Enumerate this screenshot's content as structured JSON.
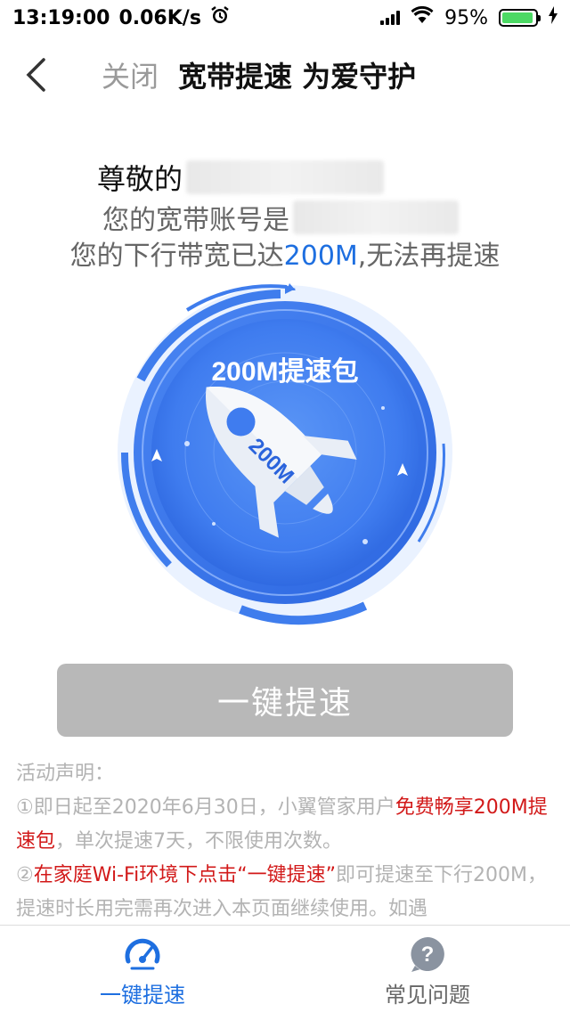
{
  "status_bar": {
    "time": "13:19:00",
    "net_speed": "0.06K/s",
    "battery_percent": "95%",
    "battery_level": 0.95
  },
  "nav": {
    "close_label": "关闭",
    "title": "宽带提速 为爱守护"
  },
  "greeting": {
    "line1_prefix": "尊敬的",
    "line2_prefix": "您的宽带账号是",
    "line3_before": "您的下行带宽已达",
    "line3_speed": "200M",
    "line3_after": ",无法再提速"
  },
  "hero": {
    "package_label": "200M提速包",
    "rocket_badge": "200M",
    "colors": {
      "primary": "#2f6fe6",
      "light": "#5a93f5"
    }
  },
  "boost_button": {
    "label": "一键提速"
  },
  "notice": {
    "title": "活动声明：",
    "item1_a": "①即日起至2020年6月30日，小翼管家用户",
    "item1_red": "免费畅享200M提速包",
    "item1_b": "，单次提速7天，不限使用次数。",
    "item2_a": "②",
    "item2_red": "在家庭Wi-Fi环境下点击“一键提速”",
    "item2_b": "即可提速至下行200M，提速时长用完需再次进入本页面继续使用。如遇"
  },
  "tabs": [
    {
      "label": "一键提速",
      "icon": "speedometer-icon",
      "active": true
    },
    {
      "label": "常见问题",
      "icon": "question-bubble-icon",
      "active": false
    }
  ]
}
